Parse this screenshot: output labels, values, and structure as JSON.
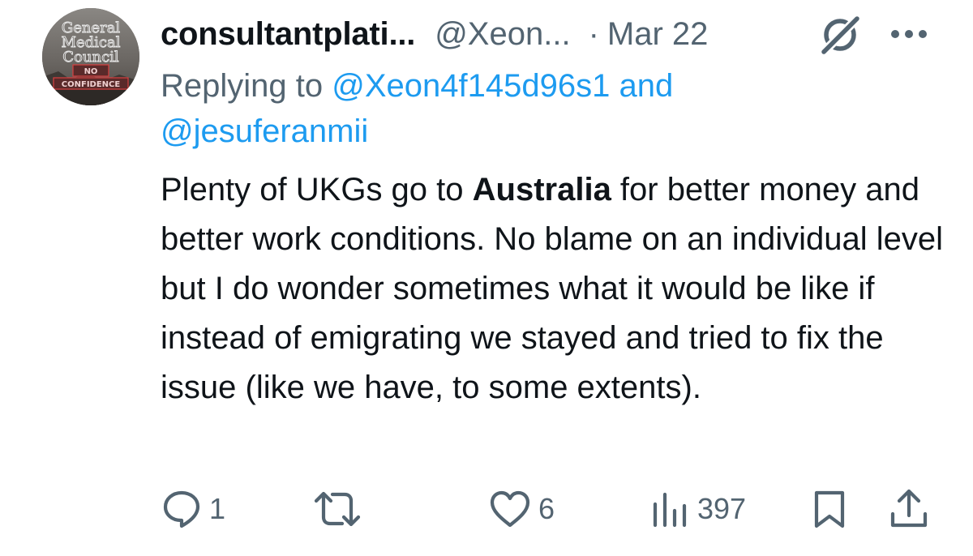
{
  "tweet": {
    "avatar": {
      "icon": "avatar-icon",
      "logo_text": [
        "General",
        "Medical",
        "Council",
        "NO",
        "CONFIDENCE"
      ]
    },
    "display_name": "consultantplati...",
    "handle": "@Xeon...",
    "separator": "·",
    "date": "Mar 22",
    "grok_icon": "grok-icon",
    "more_icon": "more-icon",
    "replying_prefix": "Replying to",
    "replying_mention_1": "@Xeon4f145d96s1",
    "replying_and": "and",
    "replying_mention_2": "@jesuferanmii",
    "body_before_bold": "Plenty of UKGs go to ",
    "body_bold": "Australia",
    "body_after_bold": " for better money and better work conditions. No blame on an individual level but I do wonder sometimes what it would be like if instead of emigrating we stayed and tried to fix the issue (like we have, to some extents).",
    "actions": {
      "reply": {
        "icon": "reply-icon",
        "count": "1"
      },
      "retweet": {
        "icon": "retweet-icon",
        "count": ""
      },
      "like": {
        "icon": "heart-icon",
        "count": "6"
      },
      "views": {
        "icon": "views-icon",
        "count": "397"
      },
      "bookmark": {
        "icon": "bookmark-icon"
      },
      "share": {
        "icon": "share-icon"
      }
    },
    "colors": {
      "text": "#0f1419",
      "secondary": "#536471",
      "link": "#1d9bf0",
      "background": "#ffffff"
    }
  }
}
